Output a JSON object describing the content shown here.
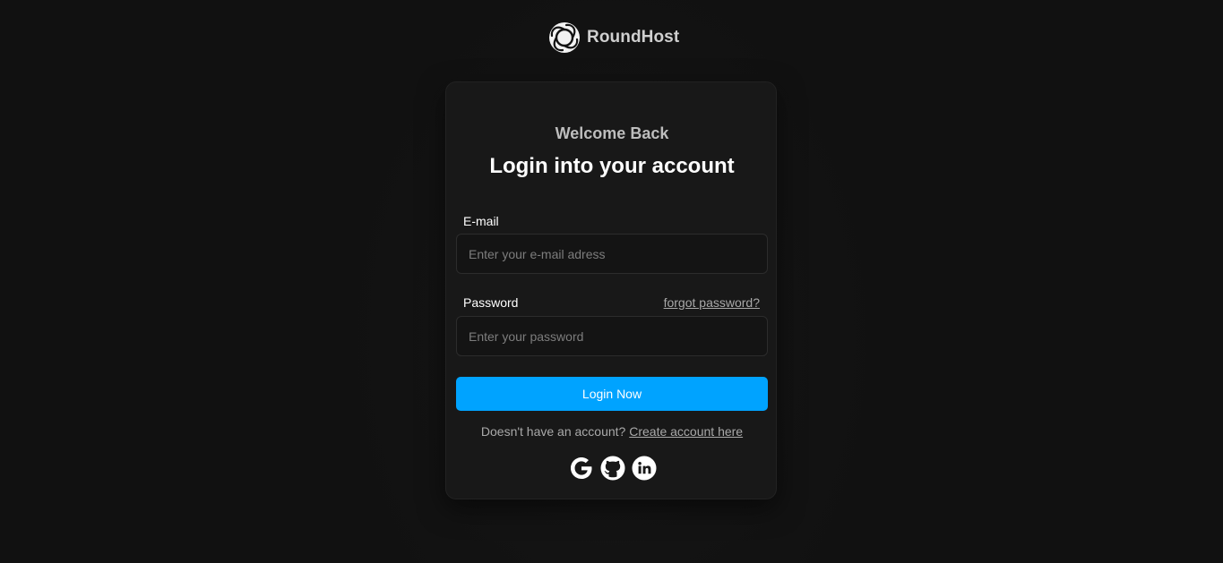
{
  "brand": {
    "name": "RoundHost",
    "logo_icon": "swirl-logo-icon"
  },
  "card": {
    "welcome": "Welcome Back",
    "headline": "Login into your account",
    "email": {
      "label": "E-mail",
      "value": "",
      "placeholder": "Enter your e-mail adress"
    },
    "password": {
      "label": "Password",
      "value": "",
      "placeholder": "Enter your password",
      "forgot_link": "forgot password?"
    },
    "login_button": "Login Now",
    "signup": {
      "prompt": "Doesn't have an account?",
      "link": "Create account here"
    },
    "socials": [
      {
        "icon": "google-icon"
      },
      {
        "icon": "github-icon"
      },
      {
        "icon": "linkedin-icon"
      }
    ]
  },
  "colors": {
    "background": "#121212",
    "card": "#181818",
    "accent": "#00a3ff",
    "muted_text": "#a9a9a9"
  }
}
